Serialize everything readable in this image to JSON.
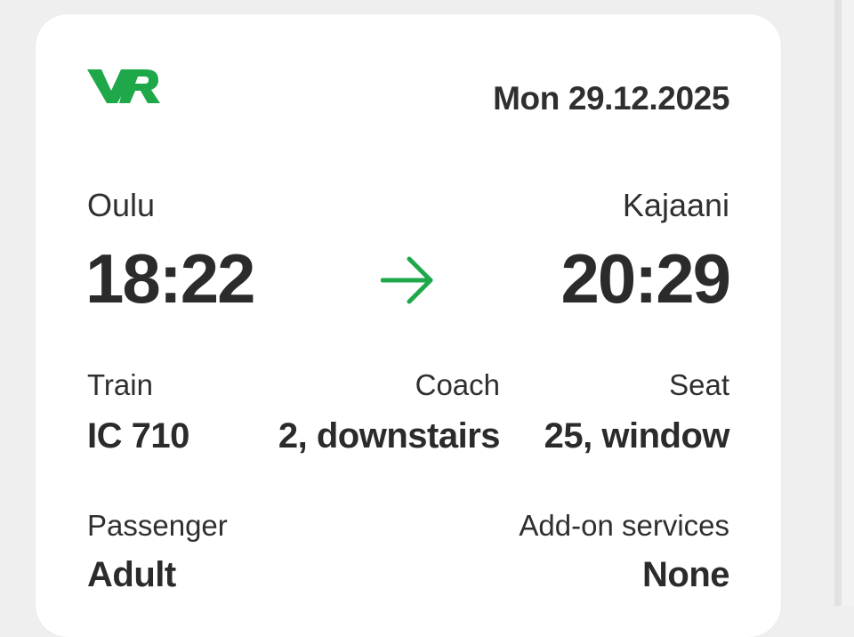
{
  "ticket": {
    "brand": "VR",
    "brand_color": "#1ea84a",
    "date": "Mon 29.12.2025",
    "route": {
      "from": "Oulu",
      "to": "Kajaani",
      "departure_time": "18:22",
      "arrival_time": "20:29",
      "arrow_icon": "arrow-right-icon"
    },
    "details": {
      "train_label": "Train",
      "train_value": "IC 710",
      "coach_label": "Coach",
      "coach_value": "2, downstairs",
      "seat_label": "Seat",
      "seat_value": "25, window"
    },
    "passenger": {
      "label": "Passenger",
      "value": "Adult"
    },
    "addons": {
      "label": "Add-on services",
      "value": "None"
    }
  }
}
